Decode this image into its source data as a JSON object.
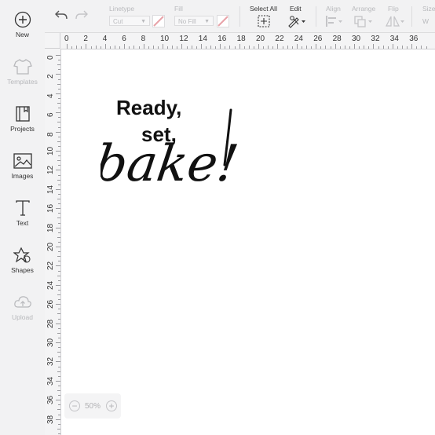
{
  "sidebar": {
    "items": [
      {
        "label": "New"
      },
      {
        "label": "Templates"
      },
      {
        "label": "Projects"
      },
      {
        "label": "Images"
      },
      {
        "label": "Text"
      },
      {
        "label": "Shapes"
      },
      {
        "label": "Upload"
      }
    ]
  },
  "toolbar": {
    "linetype_label": "Linetype",
    "linetype_value": "Cut",
    "fill_label": "Fill",
    "fill_value": "No Fill",
    "select_all_label": "Select All",
    "edit_label": "Edit",
    "align_label": "Align",
    "arrange_label": "Arrange",
    "flip_label": "Flip",
    "size_label": "Size",
    "size_w": "W"
  },
  "ruler": {
    "top": [
      "0",
      "2",
      "4",
      "6",
      "8",
      "10",
      "12",
      "14",
      "16",
      "18",
      "20",
      "22",
      "24",
      "26",
      "28",
      "30",
      "32",
      "34",
      "36"
    ],
    "left": [
      "0",
      "2",
      "4",
      "6",
      "8",
      "10",
      "12",
      "14",
      "16",
      "18",
      "20",
      "22",
      "24",
      "26",
      "28",
      "30",
      "32",
      "34",
      "36",
      "38"
    ]
  },
  "design": {
    "line1": "Ready,",
    "line2": "set,",
    "line3": "bake!"
  },
  "zoom": {
    "value": "50%",
    "minus": "−",
    "plus": "+"
  },
  "colors": {
    "sidebar_bg": "#f2f2f3",
    "ruler_bg": "#f4f4f5",
    "text_dark": "#111111",
    "swatch_red": "#e8a2a8"
  }
}
